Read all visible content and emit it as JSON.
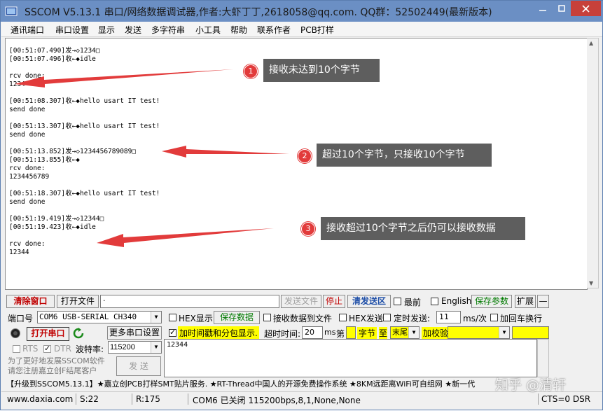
{
  "window": {
    "title": "SSCOM V5.13.1 串口/网络数据调试器,作者:大虾丁丁,2618058@qq.com. QQ群：52502449(最新版本)"
  },
  "menu": [
    "通讯端口",
    "串口设置",
    "显示",
    "发送",
    "多字符串",
    "小工具",
    "帮助",
    "联系作者",
    "PCB打样"
  ],
  "receive_lines": [
    "[00:51:07.490]发→◇1234□",
    "[00:51:07.496]收←◆idle",
    "",
    "rcv done:",
    "1234",
    "",
    "[00:51:08.307]收←◆hello usart IT test!",
    "send done",
    "",
    "[00:51:13.307]收←◆hello usart IT test!",
    "send done",
    "",
    "[00:51:13.852]发→◇1234456789089□",
    "[00:51:13.855]收←◆",
    "rcv done:",
    "1234456789",
    "",
    "[00:51:18.307]收←◆hello usart IT test!",
    "send done",
    "",
    "[00:51:19.419]发→◇12344□",
    "[00:51:19.423]收←◆idle",
    "",
    "rcv done:",
    "12344"
  ],
  "callouts": [
    {
      "num": "1",
      "text": "接收未达到10个字节"
    },
    {
      "num": "2",
      "text": "超过10个字节，只接收10个字节"
    },
    {
      "num": "3",
      "text": "接收超过10个字节之后仍可以接收数据"
    }
  ],
  "toolbar": {
    "clear_window": "清除窗口",
    "open_file": "打开文件",
    "file_path": "·",
    "send_file": "发送文件",
    "stop": "停止",
    "clear_send": "清发送区",
    "top_most": "最前",
    "english": "English",
    "save_params": "保存参数",
    "expand": "扩展",
    "collapse": "—"
  },
  "port": {
    "port_label": "端口号",
    "port_value": "COM6 USB-SERIAL CH340",
    "hex_display": "HEX显示",
    "save_data": "保存数据",
    "recv_to_file": "接收数据到文件",
    "hex_send": "HEX发送",
    "timed_send": "定时发送:",
    "interval": "11",
    "interval_unit": "ms/次",
    "add_crlf": "加回车换行",
    "open_port": "打开串口",
    "more_settings": "更多串口设置",
    "timestamp": "加时间戳和分包显示.",
    "timeout_label": "超时时间:",
    "timeout_value": "20",
    "timeout_unit": "ms",
    "nth": "第",
    "byte_label": "字节",
    "to": "至",
    "tail": "末尾",
    "checksum": "加校验",
    "rts": "RTS",
    "dtr": "DTR",
    "baud_label": "波特率:",
    "baud_value": "115200",
    "send_text": "12344",
    "send_button": "发 送",
    "promo": "为了更好地发展SSCOM软件\n请您注册嘉立创F结尾客户"
  },
  "ticker": "【升级到SSCOM5.13.1】★嘉立创PCB打样SMT贴片服务. ★RT-Thread中国人的开源免费操作系统 ★8KM远距离WiFi可自组网 ★新一代",
  "status": {
    "url": "www.daxia.com",
    "sent": "S:22",
    "received": "R:175",
    "port_state": "COM6 已关闭  115200bps,8,1,None,None",
    "lines": "CTS=0 DSR"
  },
  "watermark": "知乎 @清轩",
  "colors": {
    "titlebar": "#6b8fc4",
    "callout_bg": "#5e5e5e",
    "badge": "#e23b3b",
    "arrow": "#e23b3b",
    "yellow": "#ffff00",
    "green_text": "#007a00",
    "red_text": "#c00000"
  }
}
